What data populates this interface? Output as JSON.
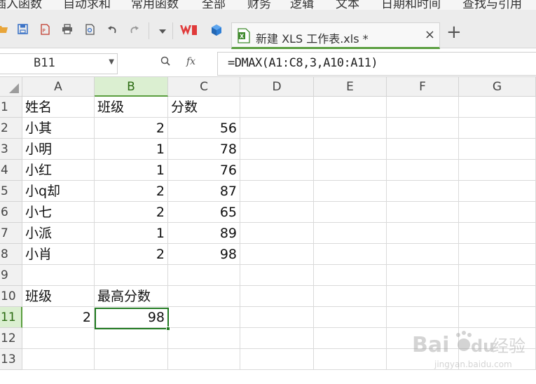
{
  "menu": {
    "items": [
      "插入函数",
      "自动求和",
      "常用函数",
      "全部",
      "财务",
      "逻辑",
      "文本",
      "日期和时间",
      "查找与引用"
    ]
  },
  "toolbar": {
    "icons": [
      "open-icon",
      "save-icon",
      "export-pdf-icon",
      "print-icon",
      "print-preview-icon",
      "undo-icon",
      "redo-icon",
      "dropdown-icon"
    ]
  },
  "tab": {
    "title": "新建 XLS 工作表.xls *"
  },
  "formula_bar": {
    "cell_ref": "B11",
    "formula": "=DMAX(A1:C8,3,A10:A11)"
  },
  "grid": {
    "columns": [
      "A",
      "B",
      "C",
      "D",
      "E",
      "F",
      "G"
    ],
    "rows": [
      "1",
      "2",
      "3",
      "4",
      "5",
      "6",
      "7",
      "8",
      "9",
      "10",
      "11",
      "12",
      "13"
    ],
    "active_column": "B",
    "active_row": "11",
    "cells": {
      "A1": "姓名",
      "B1": "班级",
      "C1": "分数",
      "A2": "小其",
      "B2": "2",
      "C2": "56",
      "A3": "小明",
      "B3": "1",
      "C3": "78",
      "A4": "小红",
      "B4": "1",
      "C4": "76",
      "A5": "小q却",
      "B5": "2",
      "C5": "87",
      "A6": "小七",
      "B6": "2",
      "C6": "65",
      "A7": "小派",
      "B7": "1",
      "C7": "89",
      "A8": "小肖",
      "B8": "2",
      "C8": "98",
      "A10": "班级",
      "B10": "最高分数",
      "A11": "2",
      "B11": "98"
    }
  },
  "watermark": {
    "brand": "Bai",
    "brand_suffix": "du",
    "product": "经验",
    "url": "jingyan.baidu.com"
  },
  "colors": {
    "accent": "#5a9e3f",
    "selection": "#217a21",
    "header_bg": "#f1f1f1",
    "active_header_bg": "#dbefd1"
  }
}
